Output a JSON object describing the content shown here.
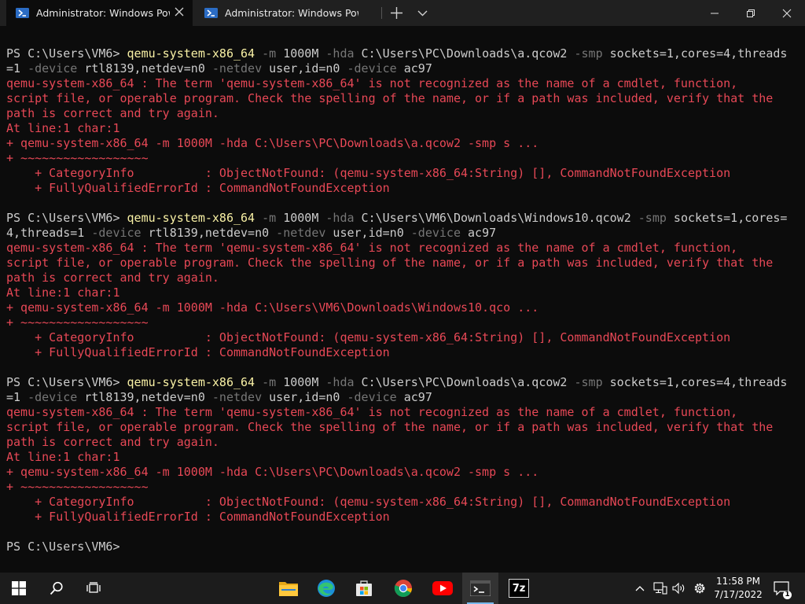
{
  "titlebar": {
    "tabs": [
      {
        "label": "Administrator: Windows PowerShell",
        "icon": "powershell-icon",
        "active": true
      },
      {
        "label": "Administrator: Windows PowerShell",
        "icon": "powershell-icon",
        "active": false
      }
    ],
    "window_controls": [
      "minimize-icon",
      "maximize-icon",
      "close-icon"
    ]
  },
  "terminal": {
    "colors": {
      "text": "#cccccc",
      "command": "#f9f1a5",
      "parameter": "#767676",
      "error": "#e74856",
      "background": "#0c0c0c"
    },
    "lines": [
      [
        {
          "t": "PS C:\\Users\\VM6> ",
          "c": "w"
        },
        {
          "t": "qemu-system-x86_64",
          "c": "y"
        },
        {
          "t": " -m",
          "c": "g"
        },
        {
          "t": " 1000M",
          "c": "w"
        },
        {
          "t": " -hda",
          "c": "g"
        },
        {
          "t": " C:\\Users\\PC\\Downloads\\a.qcow2",
          "c": "w"
        },
        {
          "t": " -smp",
          "c": "g"
        },
        {
          "t": " sockets=1,cores=4,threads",
          "c": "w"
        }
      ],
      [
        {
          "t": "=1",
          "c": "w"
        },
        {
          "t": " -device",
          "c": "g"
        },
        {
          "t": " rtl8139,netdev=n0",
          "c": "w"
        },
        {
          "t": " -netdev",
          "c": "g"
        },
        {
          "t": " user,id=n0",
          "c": "w"
        },
        {
          "t": " -device",
          "c": "g"
        },
        {
          "t": " ac97",
          "c": "w"
        }
      ],
      [
        {
          "t": "qemu-system-x86_64 : The term 'qemu-system-x86_64' is not recognized as the name of a cmdlet, function,",
          "c": "r"
        }
      ],
      [
        {
          "t": "script file, or operable program. Check the spelling of the name, or if a path was included, verify that the",
          "c": "r"
        }
      ],
      [
        {
          "t": "path is correct and try again.",
          "c": "r"
        }
      ],
      [
        {
          "t": "At line:1 char:1",
          "c": "r"
        }
      ],
      [
        {
          "t": "+ qemu-system-x86_64 -m 1000M -hda C:\\Users\\PC\\Downloads\\a.qcow2 -smp s ...",
          "c": "r"
        }
      ],
      [
        {
          "t": "+ ~~~~~~~~~~~~~~~~~~",
          "c": "r"
        }
      ],
      [
        {
          "t": "    + CategoryInfo          : ObjectNotFound: (qemu-system-x86_64:String) [], CommandNotFoundException",
          "c": "r"
        }
      ],
      [
        {
          "t": "    + FullyQualifiedErrorId : CommandNotFoundException",
          "c": "r"
        }
      ],
      [
        {
          "t": "",
          "c": "w"
        }
      ],
      [
        {
          "t": "PS C:\\Users\\VM6> ",
          "c": "w"
        },
        {
          "t": "qemu-system-x86_64",
          "c": "y"
        },
        {
          "t": " -m",
          "c": "g"
        },
        {
          "t": " 1000M",
          "c": "w"
        },
        {
          "t": " -hda",
          "c": "g"
        },
        {
          "t": " C:\\Users\\VM6\\Downloads\\Windows10.qcow2",
          "c": "w"
        },
        {
          "t": " -smp",
          "c": "g"
        },
        {
          "t": " sockets=1,cores=",
          "c": "w"
        }
      ],
      [
        {
          "t": "4,threads=1",
          "c": "w"
        },
        {
          "t": " -device",
          "c": "g"
        },
        {
          "t": " rtl8139,netdev=n0",
          "c": "w"
        },
        {
          "t": " -netdev",
          "c": "g"
        },
        {
          "t": " user,id=n0",
          "c": "w"
        },
        {
          "t": " -device",
          "c": "g"
        },
        {
          "t": " ac97",
          "c": "w"
        }
      ],
      [
        {
          "t": "qemu-system-x86_64 : The term 'qemu-system-x86_64' is not recognized as the name of a cmdlet, function,",
          "c": "r"
        }
      ],
      [
        {
          "t": "script file, or operable program. Check the spelling of the name, or if a path was included, verify that the",
          "c": "r"
        }
      ],
      [
        {
          "t": "path is correct and try again.",
          "c": "r"
        }
      ],
      [
        {
          "t": "At line:1 char:1",
          "c": "r"
        }
      ],
      [
        {
          "t": "+ qemu-system-x86_64 -m 1000M -hda C:\\Users\\VM6\\Downloads\\Windows10.qco ...",
          "c": "r"
        }
      ],
      [
        {
          "t": "+ ~~~~~~~~~~~~~~~~~~",
          "c": "r"
        }
      ],
      [
        {
          "t": "    + CategoryInfo          : ObjectNotFound: (qemu-system-x86_64:String) [], CommandNotFoundException",
          "c": "r"
        }
      ],
      [
        {
          "t": "    + FullyQualifiedErrorId : CommandNotFoundException",
          "c": "r"
        }
      ],
      [
        {
          "t": "",
          "c": "w"
        }
      ],
      [
        {
          "t": "PS C:\\Users\\VM6> ",
          "c": "w"
        },
        {
          "t": "qemu-system-x86_64",
          "c": "y"
        },
        {
          "t": " -m",
          "c": "g"
        },
        {
          "t": " 1000M",
          "c": "w"
        },
        {
          "t": " -hda",
          "c": "g"
        },
        {
          "t": " C:\\Users\\PC\\Downloads\\a.qcow2",
          "c": "w"
        },
        {
          "t": " -smp",
          "c": "g"
        },
        {
          "t": " sockets=1,cores=4,threads",
          "c": "w"
        }
      ],
      [
        {
          "t": "=1",
          "c": "w"
        },
        {
          "t": " -device",
          "c": "g"
        },
        {
          "t": " rtl8139,netdev=n0",
          "c": "w"
        },
        {
          "t": " -netdev",
          "c": "g"
        },
        {
          "t": " user,id=n0",
          "c": "w"
        },
        {
          "t": " -device",
          "c": "g"
        },
        {
          "t": " ac97",
          "c": "w"
        }
      ],
      [
        {
          "t": "qemu-system-x86_64 : The term 'qemu-system-x86_64' is not recognized as the name of a cmdlet, function,",
          "c": "r"
        }
      ],
      [
        {
          "t": "script file, or operable program. Check the spelling of the name, or if a path was included, verify that the",
          "c": "r"
        }
      ],
      [
        {
          "t": "path is correct and try again.",
          "c": "r"
        }
      ],
      [
        {
          "t": "At line:1 char:1",
          "c": "r"
        }
      ],
      [
        {
          "t": "+ qemu-system-x86_64 -m 1000M -hda C:\\Users\\PC\\Downloads\\a.qcow2 -smp s ...",
          "c": "r"
        }
      ],
      [
        {
          "t": "+ ~~~~~~~~~~~~~~~~~~",
          "c": "r"
        }
      ],
      [
        {
          "t": "    + CategoryInfo          : ObjectNotFound: (qemu-system-x86_64:String) [], CommandNotFoundException",
          "c": "r"
        }
      ],
      [
        {
          "t": "    + FullyQualifiedErrorId : CommandNotFoundException",
          "c": "r"
        }
      ],
      [
        {
          "t": "",
          "c": "w"
        }
      ],
      [
        {
          "t": "PS C:\\Users\\VM6>",
          "c": "w"
        }
      ]
    ]
  },
  "taskbar": {
    "start_icon": "windows-start-icon",
    "pinned": [
      {
        "name": "search-icon",
        "active": false
      },
      {
        "name": "task-view-icon",
        "active": false
      },
      {
        "name": "file-explorer-icon",
        "active": false
      },
      {
        "name": "edge-icon",
        "active": false
      },
      {
        "name": "microsoft-store-icon",
        "active": false
      },
      {
        "name": "chrome-icon",
        "active": false
      },
      {
        "name": "youtube-icon",
        "active": false
      },
      {
        "name": "terminal-icon",
        "active": true
      },
      {
        "name": "7zip-icon",
        "active": false
      }
    ],
    "sevenzip_label": "7z",
    "tray_icons": [
      "chevron-up-icon",
      "network-icon",
      "volume-icon",
      "settings-icon"
    ],
    "clock": {
      "time": "11:58 PM",
      "date": "7/17/2022"
    },
    "notification_count": "1"
  }
}
